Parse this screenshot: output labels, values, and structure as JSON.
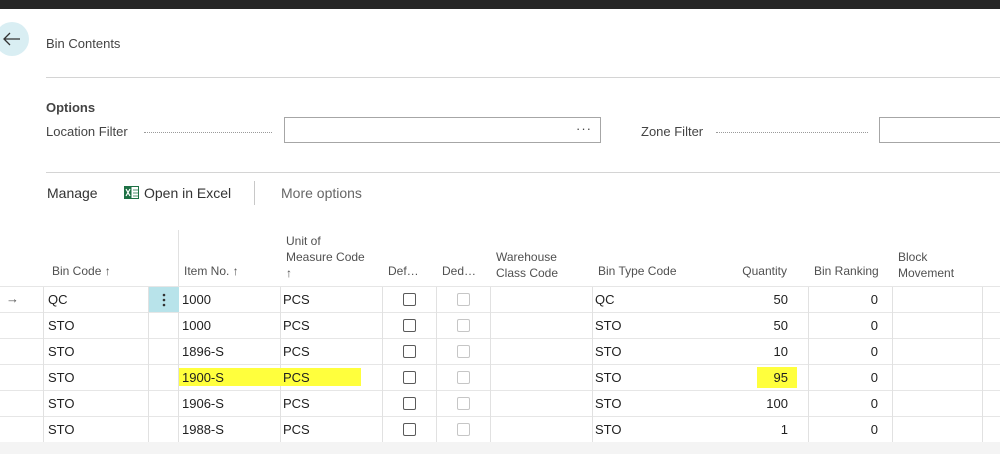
{
  "page": {
    "title": "Bin Contents"
  },
  "options": {
    "title": "Options",
    "location_filter_label": "Location Filter",
    "location_filter_value": "",
    "zone_filter_label": "Zone Filter",
    "zone_filter_value": ""
  },
  "actions": {
    "manage": "Manage",
    "open_in_excel": "Open in Excel",
    "more_options": "More options"
  },
  "columns": {
    "bin_code": "Bin Code ↑",
    "item_no": "Item No. ↑",
    "uom_line1": "Unit of",
    "uom_line2": "Measure Code",
    "uom_sort": "↑",
    "default": "Def…",
    "dedicated": "Ded…",
    "wh_class_line1": "Warehouse",
    "wh_class_line2": "Class Code",
    "bin_type_code": "Bin Type Code",
    "quantity": "Quantity",
    "bin_ranking": "Bin Ranking",
    "block_line1": "Block",
    "block_line2": "Movement"
  },
  "rows": [
    {
      "bin_code": "QC",
      "item_no": "1000",
      "uom": "PCS",
      "default": false,
      "dedicated": false,
      "wh_class": "",
      "bin_type": "QC",
      "quantity": "50",
      "bin_ranking": "0",
      "block": ""
    },
    {
      "bin_code": "STO",
      "item_no": "1000",
      "uom": "PCS",
      "default": false,
      "dedicated": false,
      "wh_class": "",
      "bin_type": "STO",
      "quantity": "50",
      "bin_ranking": "0",
      "block": ""
    },
    {
      "bin_code": "STO",
      "item_no": "1896-S",
      "uom": "PCS",
      "default": false,
      "dedicated": false,
      "wh_class": "",
      "bin_type": "STO",
      "quantity": "10",
      "bin_ranking": "0",
      "block": ""
    },
    {
      "bin_code": "STO",
      "item_no": "1900-S",
      "uom": "PCS",
      "default": false,
      "dedicated": false,
      "wh_class": "",
      "bin_type": "STO",
      "quantity": "95",
      "bin_ranking": "0",
      "block": ""
    },
    {
      "bin_code": "STO",
      "item_no": "1906-S",
      "uom": "PCS",
      "default": false,
      "dedicated": false,
      "wh_class": "",
      "bin_type": "STO",
      "quantity": "100",
      "bin_ranking": "0",
      "block": ""
    },
    {
      "bin_code": "STO",
      "item_no": "1988-S",
      "uom": "PCS",
      "default": false,
      "dedicated": false,
      "wh_class": "",
      "bin_type": "STO",
      "quantity": "1",
      "bin_ranking": "0",
      "block": ""
    }
  ],
  "highlight_color": "#ffff3d",
  "accent_color": "#b8e3ea"
}
